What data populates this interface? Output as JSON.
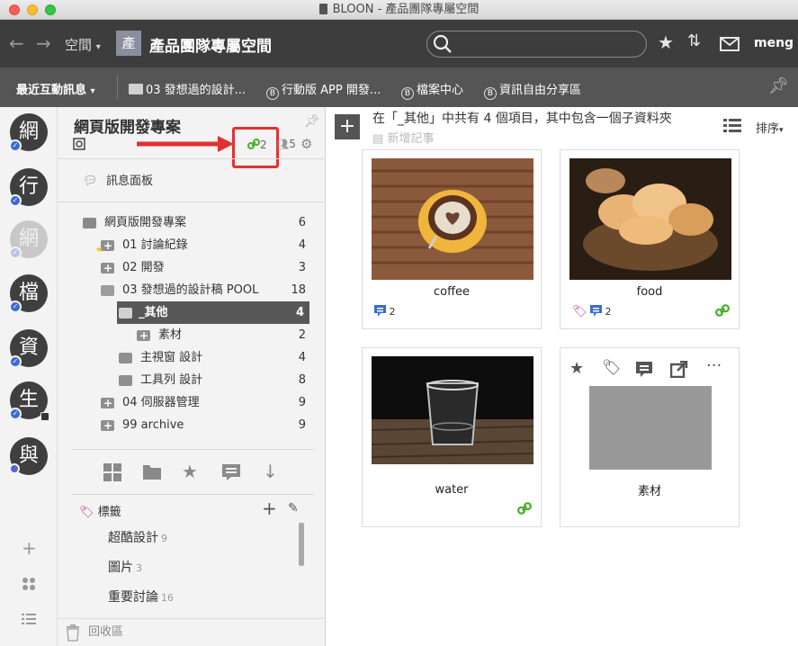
{
  "window": {
    "title": "BLOON - 產品團隊專屬空間"
  },
  "toolbar": {
    "space_menu": "空間",
    "space_avatar": "產",
    "space_title": "產品團隊專屬空間",
    "search_placeholder": "",
    "user": "meng"
  },
  "bookmarks": {
    "recent": "最近互動訊息",
    "items": [
      {
        "label": "03 發想過的設計...",
        "icon": "folder-icon"
      },
      {
        "label": "行動版 APP 開發...",
        "icon": "b-circle-icon"
      },
      {
        "label": "檔案中心",
        "icon": "b-circle-icon"
      },
      {
        "label": "資訊自由分享區",
        "icon": "b-circle-icon"
      }
    ]
  },
  "workspaces": [
    {
      "label": "網"
    },
    {
      "label": "行"
    },
    {
      "label": "網"
    },
    {
      "label": "檔"
    },
    {
      "label": "資"
    },
    {
      "label": "生"
    },
    {
      "label": "與"
    }
  ],
  "sidebar": {
    "project_title": "網頁版開發專案",
    "link_count": "2",
    "member_count": "5",
    "message_board": "訊息面板",
    "tree": [
      {
        "label": "網頁版開發專案",
        "count": "6"
      },
      {
        "label": "01 討論紀錄",
        "count": "4"
      },
      {
        "label": "02 開發",
        "count": "3"
      },
      {
        "label": "03 發想過的設計稿 POOL",
        "count": "18"
      },
      {
        "label": "_其他",
        "count": "4"
      },
      {
        "label": "素材",
        "count": "2"
      },
      {
        "label": "主視窗 設計",
        "count": "4"
      },
      {
        "label": "工具列 設計",
        "count": "8"
      },
      {
        "label": "04 伺服器管理",
        "count": "9"
      },
      {
        "label": "99 archive",
        "count": "9"
      }
    ],
    "tags_label": "標籤",
    "tags": [
      {
        "label": "超酷設計",
        "count": "9"
      },
      {
        "label": "圖片",
        "count": "3"
      },
      {
        "label": "重要討論",
        "count": "16"
      }
    ],
    "trash": "回收區"
  },
  "main": {
    "header": "在「_其他」中共有 4 個項目，其中包含一個子資料夾",
    "new_note": "新增記事",
    "sort": "排序",
    "cards": [
      {
        "name": "coffee",
        "comments": "2"
      },
      {
        "name": "food",
        "comments": "2"
      },
      {
        "name": "water"
      },
      {
        "name": "素材"
      }
    ]
  },
  "colors": {
    "accent": "#3b69d6",
    "link_green": "#4caf2f",
    "tag_pink": "#d6338a",
    "annotation_red": "#e23131"
  }
}
